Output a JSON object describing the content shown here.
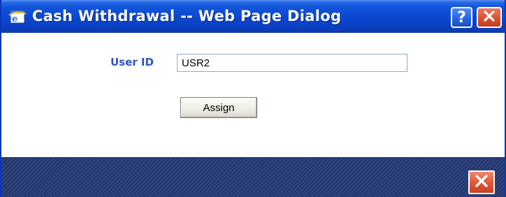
{
  "window": {
    "title": "Cash Withdrawal -- Web Page Dialog",
    "help_label": "?",
    "title_icon": "ie-dialog-icon",
    "close_icon": "close-icon"
  },
  "form": {
    "user_id_label": "User ID",
    "user_id_value": "USR2",
    "assign_label": "Assign"
  },
  "footer": {
    "close_icon": "close-icon"
  },
  "colors": {
    "titlebar": "#0a47cf",
    "label": "#2f55c4",
    "footer": "#2b3e74",
    "close": "#d9502f"
  }
}
